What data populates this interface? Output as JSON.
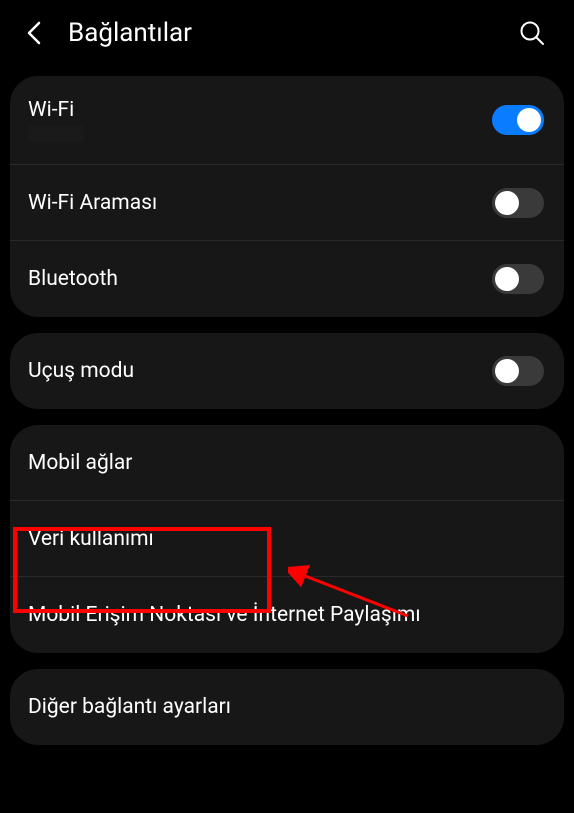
{
  "header": {
    "title": "Bağlantılar"
  },
  "groups": [
    {
      "items": [
        {
          "label": "Wi-Fi",
          "toggle": true,
          "on": true,
          "subRedacted": true
        },
        {
          "label": "Wi-Fi Araması",
          "toggle": true,
          "on": false
        },
        {
          "label": "Bluetooth",
          "toggle": true,
          "on": false
        }
      ]
    },
    {
      "items": [
        {
          "label": "Uçuş modu",
          "toggle": true,
          "on": false
        }
      ]
    },
    {
      "items": [
        {
          "label": "Mobil ağlar",
          "toggle": false
        },
        {
          "label": "Veri kullanımı",
          "toggle": false,
          "highlighted": true
        },
        {
          "label": "Mobil Erişim Noktası ve İnternet Paylaşımı",
          "toggle": false
        }
      ]
    },
    {
      "items": [
        {
          "label": "Diğer bağlantı ayarları",
          "toggle": false
        }
      ]
    }
  ]
}
